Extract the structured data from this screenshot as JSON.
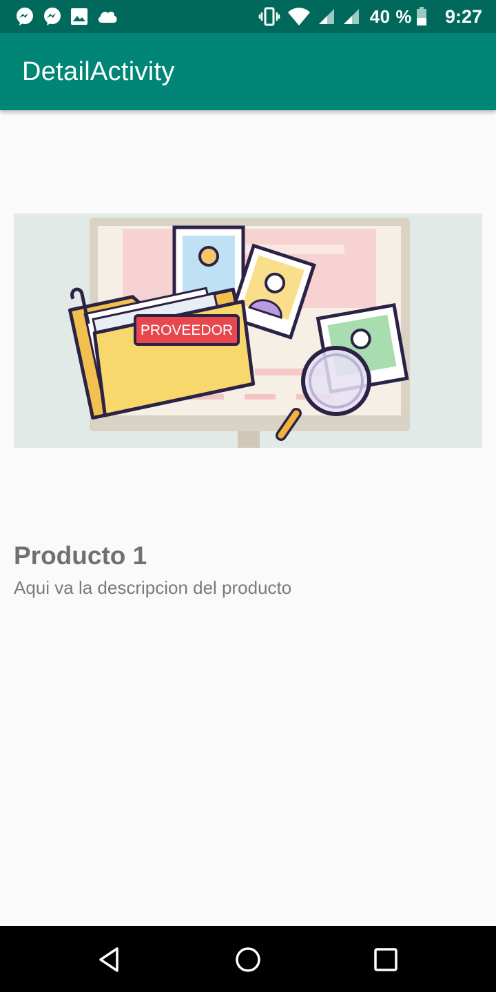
{
  "status_bar": {
    "left_icons": [
      "messenger-icon",
      "messenger-icon",
      "image-icon",
      "cloud-icon"
    ],
    "right_icons": [
      "vibrate-icon",
      "wifi-icon",
      "signal-icon",
      "signal-icon",
      "battery-icon"
    ],
    "battery": "40 %",
    "time": "9:27"
  },
  "app_bar": {
    "title": "DetailActivity",
    "color": "#008577",
    "status_color": "#00695c"
  },
  "product": {
    "image_label": "PROVEEDOR",
    "name": "Producto 1",
    "description": "Aqui va la descripcion del producto"
  },
  "nav_bar": {
    "buttons": [
      "back-icon",
      "home-icon",
      "recents-icon"
    ]
  }
}
